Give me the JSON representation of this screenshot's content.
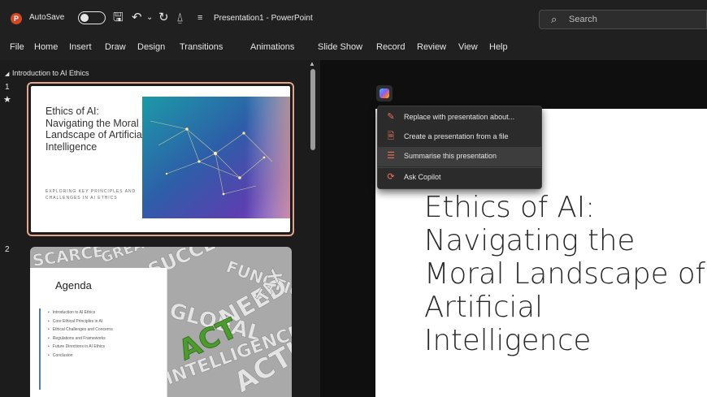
{
  "titlebar": {
    "autosave_label": "AutoSave",
    "document_title": "Presentation1 - PowerPoint",
    "search_placeholder": "Search"
  },
  "menu": [
    "File",
    "Home",
    "Insert",
    "Draw",
    "Design",
    "Transitions",
    "Animations",
    "Slide Show",
    "Record",
    "Review",
    "View",
    "Help"
  ],
  "thumbnails": {
    "section_title": "Introduction to AI Ethics",
    "slide1": {
      "number": "1",
      "star": "★",
      "title": "Ethics of AI: Navigating the Moral Landscape of Artificial Intelligence",
      "subtitle": "EXPLORING KEY PRINCIPLES AND CHALLENGES IN AI ETHICS"
    },
    "slide2": {
      "number": "2",
      "title": "Agenda",
      "items": [
        "Introduction to AI Ethics",
        "Core Ethical Principles in AI",
        "Ethical Challenges and Concerns",
        "Regulations and Frameworks",
        "Future Directions in AI Ethics",
        "Conclusion"
      ],
      "word_cloud": [
        "ACT",
        "SUCCESS",
        "GLOBAL",
        "NEED",
        "TAX",
        "ACTION",
        "INTELLIGENCE",
        "FUNCTION",
        "GREAT",
        "SCARCE"
      ]
    }
  },
  "editor": {
    "slide_title": "Ethics of AI: Navigating the Moral Landscape of Artificial Intelligence"
  },
  "copilot_menu": {
    "items": [
      {
        "label": "Replace with presentation about...",
        "icon": "pencil-sparkle-icon",
        "highlighted": false
      },
      {
        "label": "Create a presentation from a file",
        "icon": "file-create-icon",
        "highlighted": false
      },
      {
        "label": "Summarise this presentation",
        "icon": "summary-icon",
        "highlighted": true
      },
      {
        "label": "Ask Copilot",
        "icon": "copilot-icon",
        "highlighted": false
      }
    ]
  },
  "colors": {
    "accent": "#d24726",
    "selection_border": "#e4a58f",
    "agenda_bar": "#4c7ab8"
  }
}
